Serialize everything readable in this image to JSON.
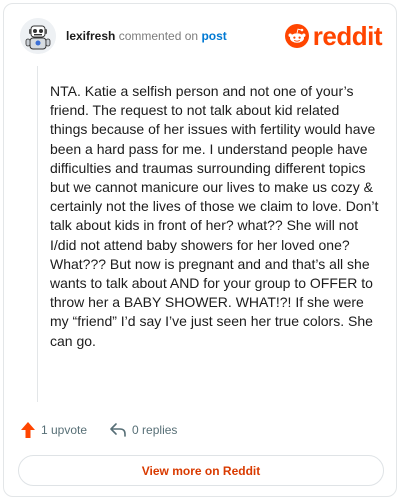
{
  "header": {
    "username": "lexifresh",
    "action_text": "commented on",
    "target_text": "post"
  },
  "brand": {
    "wordmark": "reddit",
    "color": "#ff4500"
  },
  "comment": {
    "body": "NTA. Katie a selfish person and not one of your’s friend. The request to not talk about kid related things because of her issues with fertility would have been a hard pass for me. I understand people have difficulties and traumas surrounding different topics but we cannot manicure our lives to make us cozy & certainly not the lives of those we claim to love. Don’t talk about kids in front of her? what?? She will not I/did not attend baby showers for her loved one? What??? But now is pregnant and and that’s all she wants to talk about AND for your group to OFFER to throw her a BABY SHOWER. WHAT!?! If she were my “friend” I’d say I’ve just seen her true colors. She can go."
  },
  "footer": {
    "upvotes": "1 upvote",
    "replies": "0 replies",
    "upvote_color": "#ff4500"
  },
  "cta": {
    "label": "View more on Reddit",
    "color": "#d93a00"
  },
  "icons": {
    "avatar": "robot-avatar-icon",
    "logo": "reddit-alien-icon",
    "upvote": "upvote-arrow-icon",
    "reply": "reply-arrow-icon"
  }
}
